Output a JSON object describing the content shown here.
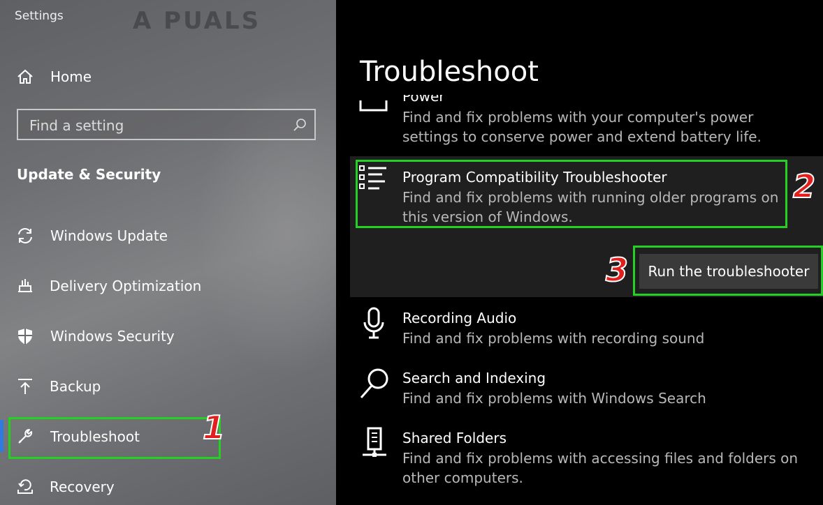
{
  "window": {
    "title": "Settings"
  },
  "logo": {
    "text": "A  PUALS"
  },
  "sidebar": {
    "home": {
      "label": "Home",
      "icon": "home-icon"
    },
    "search": {
      "placeholder": "Find a setting",
      "icon": "search-icon"
    },
    "section_title": "Update & Security",
    "items": [
      {
        "label": "Windows Update",
        "icon": "sync-icon"
      },
      {
        "label": "Delivery Optimization",
        "icon": "delivery-optimization-icon"
      },
      {
        "label": "Windows Security",
        "icon": "shield-icon"
      },
      {
        "label": "Backup",
        "icon": "backup-arrow-icon"
      },
      {
        "label": "Troubleshoot",
        "icon": "wrench-icon",
        "selected": true
      },
      {
        "label": "Recovery",
        "icon": "recovery-icon"
      }
    ]
  },
  "main": {
    "title": "Troubleshoot",
    "items": [
      {
        "name": "Power",
        "description": "Find and fix problems with your computer's power settings to conserve power and extend battery life.",
        "icon": "battery-icon"
      },
      {
        "name": "Program Compatibility Troubleshooter",
        "description": "Find and fix problems with running older programs on this version of Windows.",
        "icon": "list-icon",
        "expanded": true
      },
      {
        "name": "Recording Audio",
        "description": "Find and fix problems with recording sound",
        "icon": "microphone-icon"
      },
      {
        "name": "Search and Indexing",
        "description": "Find and fix problems with Windows Search",
        "icon": "magnifier-icon"
      },
      {
        "name": "Shared Folders",
        "description": "Find and fix problems with accessing files and folders on other computers.",
        "icon": "network-drive-icon"
      }
    ],
    "run_button_label": "Run the troubleshooter"
  },
  "annotations": {
    "step1": "1",
    "step2": "2",
    "step3": "3"
  },
  "colors": {
    "annotation_box": "#23d023",
    "annotation_number": "#e0201e",
    "selected_indicator": "#2f7be0"
  }
}
